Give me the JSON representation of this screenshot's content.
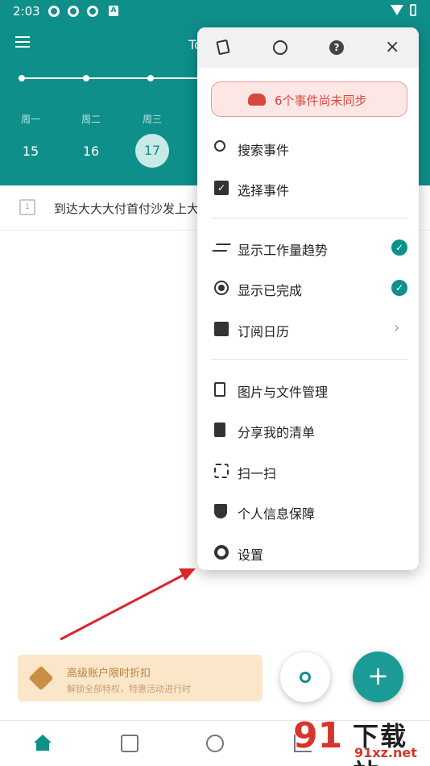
{
  "status_bar": {
    "time": "2:03",
    "letter_icon": "A"
  },
  "header": {
    "title": "To",
    "week": [
      {
        "weekday": "周一",
        "day": "15"
      },
      {
        "weekday": "周二",
        "day": "16"
      },
      {
        "weekday": "周三",
        "day": "17",
        "selected": true
      }
    ]
  },
  "task": {
    "text": "到达大大大付首付沙发上大",
    "check_label": "1"
  },
  "popup": {
    "top_icons": [
      "skin-icon",
      "globe-icon",
      "help-icon",
      "close-icon"
    ],
    "close_glyph": "×",
    "help_glyph": "?",
    "sync_text": "6个事件尚未同步",
    "group1": [
      {
        "icon": "search-icon",
        "label": "搜索事件"
      },
      {
        "icon": "select-icon",
        "label": "选择事件"
      }
    ],
    "group2": [
      {
        "icon": "trend-icon",
        "label": "显示工作量趋势",
        "checked": true
      },
      {
        "icon": "completed-icon",
        "label": "显示已完成",
        "checked": true
      },
      {
        "icon": "rss-icon",
        "label": "订阅日历",
        "chevron": "›"
      }
    ],
    "group3": [
      {
        "icon": "file-icon",
        "label": "图片与文件管理"
      },
      {
        "icon": "share-list-icon",
        "label": "分享我的清单"
      },
      {
        "icon": "scan-icon",
        "label": "扫一扫"
      },
      {
        "icon": "shield-icon",
        "label": "个人信息保障"
      },
      {
        "icon": "gear-icon",
        "label": "设置"
      }
    ],
    "check_glyph": "✓"
  },
  "promo": {
    "title": "高级账户限时折扣",
    "subtitle": "解锁全部特权，特惠活动进行时"
  },
  "fab": {
    "add_glyph": "+"
  },
  "watermark": {
    "badge": "91",
    "title": "下载站",
    "url": "91xz.net"
  },
  "colors": {
    "teal": "#0f8f8a",
    "sync_red": "#d84840",
    "promo_bg": "#fbe6c9",
    "arrow_red": "#d8272b"
  }
}
